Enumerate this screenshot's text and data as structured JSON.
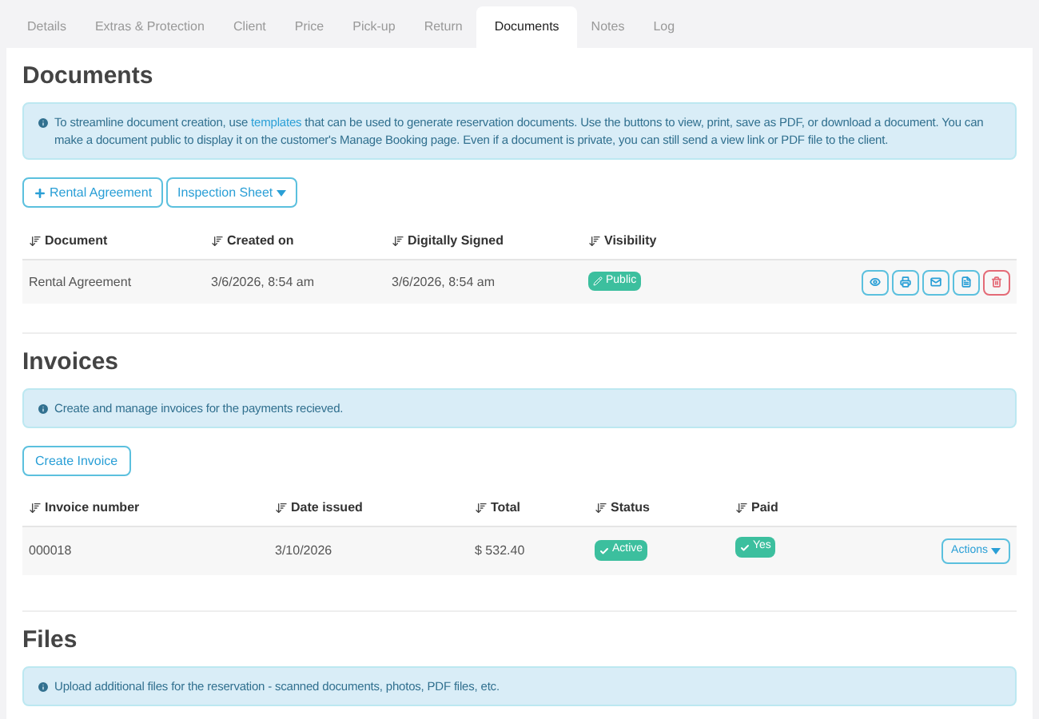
{
  "tabs": [
    {
      "label": "Details",
      "selected": false
    },
    {
      "label": "Extras & Protection",
      "selected": false
    },
    {
      "label": "Client",
      "selected": false
    },
    {
      "label": "Price",
      "selected": false
    },
    {
      "label": "Pick-up",
      "selected": false
    },
    {
      "label": "Return",
      "selected": false
    },
    {
      "label": "Documents",
      "selected": true
    },
    {
      "label": "Notes",
      "selected": false
    },
    {
      "label": "Log",
      "selected": false
    }
  ],
  "documents": {
    "title": "Documents",
    "info": {
      "before": "To streamline document creation, use",
      "link": "templates",
      "after": "that can be used to generate reservation documents. Use the buttons to view, print, save as PDF, or download a document. You can make a document public to display it on the customer's Manage Booking page. Even if a document is private, you can still send a view link or PDF file to the client."
    },
    "buttons": [
      {
        "label": "Rental Agreement",
        "kind": "add"
      },
      {
        "label": "Inspection Sheet",
        "kind": "dropdown"
      }
    ],
    "columns": [
      "Document",
      "Created on",
      "Digitally Signed",
      "Visibility"
    ],
    "rows": [
      {
        "document": "Rental Agreement",
        "created_on": "3/6/2026, 8:54 am",
        "digitally_signed": "3/6/2026, 8:54 am",
        "visibility": "Public"
      }
    ]
  },
  "invoices": {
    "title": "Invoices",
    "info": "Create and manage invoices for the payments recieved.",
    "button": "Create Invoice",
    "columns": [
      "Invoice number",
      "Date issued",
      "Total",
      "Status",
      "Paid"
    ],
    "rows": [
      {
        "invoice_number": "000018",
        "date_issued": "3/10/2026",
        "total": "$ 532.40",
        "status": "Active",
        "paid": "Yes",
        "actions": "Actions"
      }
    ]
  },
  "files": {
    "title": "Files",
    "info": "Upload additional files for the reservation - scanned documents, photos, PDF files, etc."
  }
}
